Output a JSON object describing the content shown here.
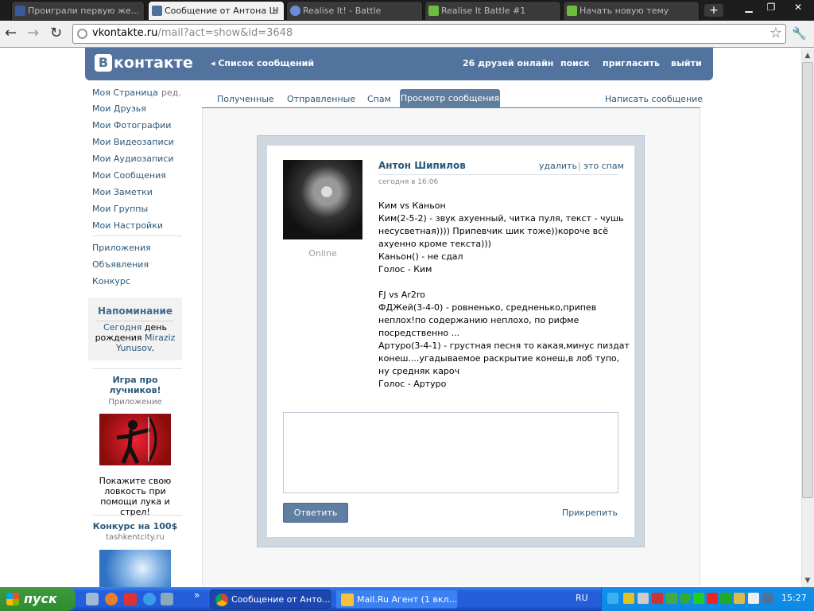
{
  "browser": {
    "tabs": [
      {
        "title": "Проиграли первую же...",
        "active": false
      },
      {
        "title": "Сообщение от Антона Ш",
        "active": true
      },
      {
        "title": "Realise It! - Battle",
        "active": false
      },
      {
        "title": "Realise It Battle #1",
        "active": false
      },
      {
        "title": "Начать новую тему",
        "active": false
      }
    ],
    "new_tab": "+",
    "win_min": "▁",
    "win_max": "❐",
    "win_close": "✕",
    "back": "←",
    "forward": "→",
    "reload": "↻",
    "url_host": "vkontakte.ru",
    "url_path": "/mail?act=show&id=3648",
    "star": "☆",
    "wrench": "🔧"
  },
  "header": {
    "logo_b": "В",
    "logo_text": "контакте",
    "back_link": "Список сообщений",
    "friends_online": "26 друзей онлайн",
    "search": "поиск",
    "invite": "пригласить",
    "logout": "выйти"
  },
  "sidebar": {
    "items": [
      "Моя Страница",
      "Мои Друзья",
      "Мои Фотографии",
      "Мои Видеозаписи",
      "Мои Аудиозаписи",
      "Мои Сообщения",
      "Мои Заметки",
      "Мои Группы",
      "Мои Настройки"
    ],
    "edit": "ред.",
    "apps": [
      "Приложения",
      "Объявления",
      "Конкурс"
    ],
    "reminder": {
      "title": "Напоминание",
      "today": "Сегодня",
      "mid": " день рождения ",
      "name": "Miraziz Yunusov",
      "dot": "."
    },
    "ad1": {
      "title": "Игра про лучников!",
      "sub": "Приложение",
      "text": "Покажите свою ловкость при помощи лука и стрел!"
    },
    "ad2": {
      "title": "Конкурс на 100$",
      "sub": "tashkentcity.ru"
    }
  },
  "mail": {
    "tabs": [
      "Полученные",
      "Отправленные",
      "Спам"
    ],
    "active_tab": "Просмотр сообщения",
    "write": "Написать сообщение",
    "sender": "Антон Шипилов",
    "delete": "удалить",
    "sep": "|",
    "spam": "это спам",
    "date": "сегодня в 16:06",
    "online": "Online",
    "lines": [
      "Ким vs Каньон",
      "Ким(2-5-2) - звук ахуенный, читка пуля, текст - чушь",
      "несусветная)))) Припевчик шик тоже))короче всё",
      "ахуенно кроме текста)))",
      "Каньон() - не сдал",
      "Голос - Ким",
      "",
      "FJ vs Ar2ro",
      "ФДЖей(3-4-0) - ровненько, средненько,припев",
      "неплох!по содержанию неплохо, по рифме",
      "посредственно ...",
      "Артуро(3-4-1) - грустная песня то какая,минус пиздат",
      "конеш....угадываемое раскрытие конеш,в лоб тупо,",
      "ну средняк кароч",
      "Голос - Артуро"
    ],
    "reply_button": "Ответить",
    "attach": "Прикрепить"
  },
  "scroll": {
    "up": "▲",
    "down": "▼"
  },
  "taskbar": {
    "start": "пуск",
    "more": "»",
    "tasks": [
      "Сообщение от Анто...",
      "Mail.Ru Агент (1 вкл..."
    ],
    "lang": "RU",
    "time": "15:27"
  }
}
